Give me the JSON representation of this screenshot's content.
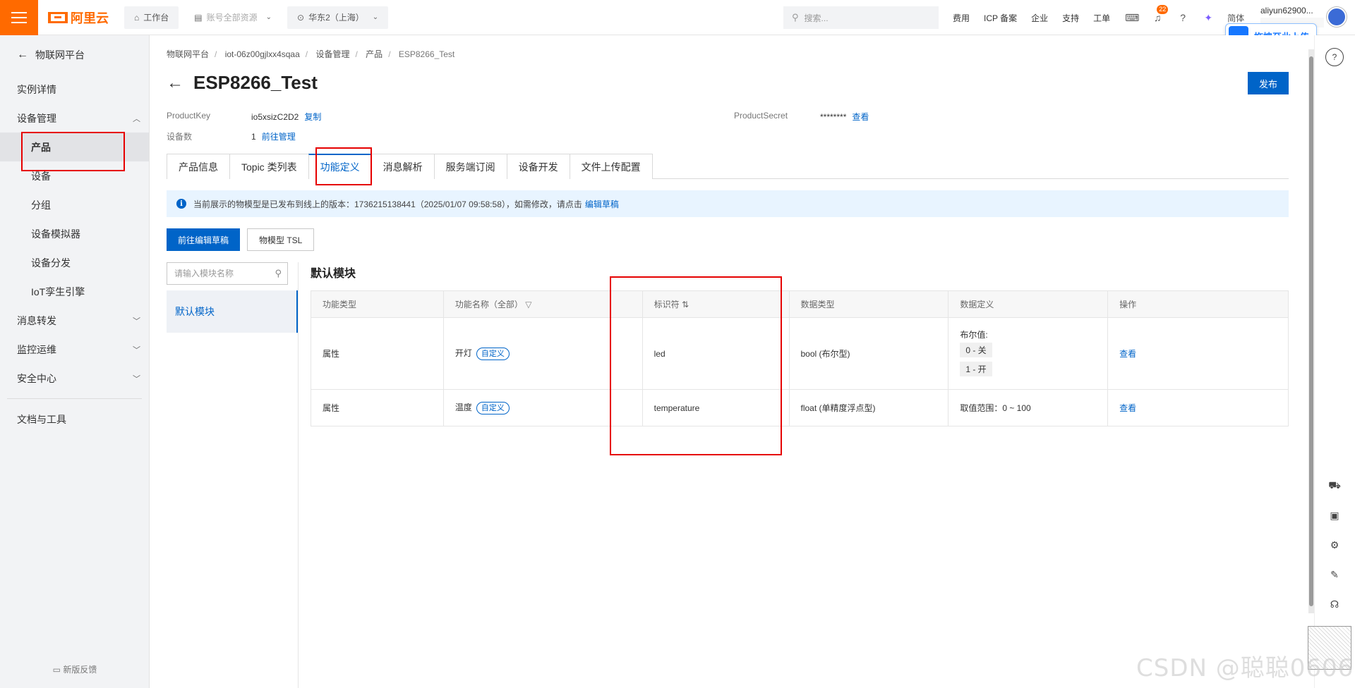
{
  "topbar": {
    "logo_text": "阿里云",
    "workbench": "工作台",
    "account_resources": "账号全部资源",
    "region": "华东2（上海）",
    "search_placeholder": "搜索...",
    "links": [
      "费用",
      "ICP 备案",
      "企业",
      "支持",
      "工单"
    ],
    "notification_count": "22",
    "lang": "简体",
    "username": "aliyun62900...",
    "upload_button": "拖拽至此上传"
  },
  "sidebar": {
    "back_label": "物联网平台",
    "items": [
      {
        "label": "实例详情"
      },
      {
        "label": "设备管理"
      },
      {
        "label": "产品"
      },
      {
        "label": "设备"
      },
      {
        "label": "分组"
      },
      {
        "label": "设备模拟器"
      },
      {
        "label": "设备分发"
      },
      {
        "label": "IoT孪生引擎"
      },
      {
        "label": "消息转发"
      },
      {
        "label": "监控运维"
      },
      {
        "label": "安全中心"
      },
      {
        "label": "文档与工具"
      }
    ],
    "feedback": "新版反馈"
  },
  "breadcrumb": [
    "物联网平台",
    "iot-06z00gjlxx4sqaa",
    "设备管理",
    "产品",
    "ESP8266_Test"
  ],
  "page": {
    "title": "ESP8266_Test",
    "publish_button": "发布",
    "product_key_label": "ProductKey",
    "product_key_value": "io5xsizC2D2",
    "copy_link": "复制",
    "device_count_label": "设备数",
    "device_count_value": "1",
    "manage_link": "前往管理",
    "product_secret_label": "ProductSecret",
    "product_secret_value": "********",
    "view_link": "查看"
  },
  "tabs": [
    "产品信息",
    "Topic 类列表",
    "功能定义",
    "消息解析",
    "服务端订阅",
    "设备开发",
    "文件上传配置"
  ],
  "notice": {
    "text": "当前展示的物模型是已发布到线上的版本：1736215138441（2025/01/07 09:58:58），如需修改，请点击",
    "link": "编辑草稿"
  },
  "actions": {
    "edit_draft": "前往编辑草稿",
    "tsl": "物模型 TSL"
  },
  "modules": {
    "search_placeholder": "请输入模块名称",
    "items": [
      "默认模块"
    ],
    "section_title": "默认模块"
  },
  "table": {
    "headers": [
      "功能类型",
      "功能名称（全部）",
      "标识符 ⇅",
      "数据类型",
      "数据定义",
      "操作"
    ],
    "rows": [
      {
        "type": "属性",
        "name": "开灯",
        "tag": "自定义",
        "identifier": "led",
        "data_type": "bool (布尔型)",
        "def_label": "布尔值:",
        "def_0": "0 - 关",
        "def_1": "1 - 开",
        "action": "查看"
      },
      {
        "type": "属性",
        "name": "温度",
        "tag": "自定义",
        "identifier": "temperature",
        "data_type": "float (单精度浮点型)",
        "def_range": "取值范围：0 ~ 100",
        "action": "查看"
      }
    ]
  },
  "watermark": "CSDN @聪聪0606"
}
